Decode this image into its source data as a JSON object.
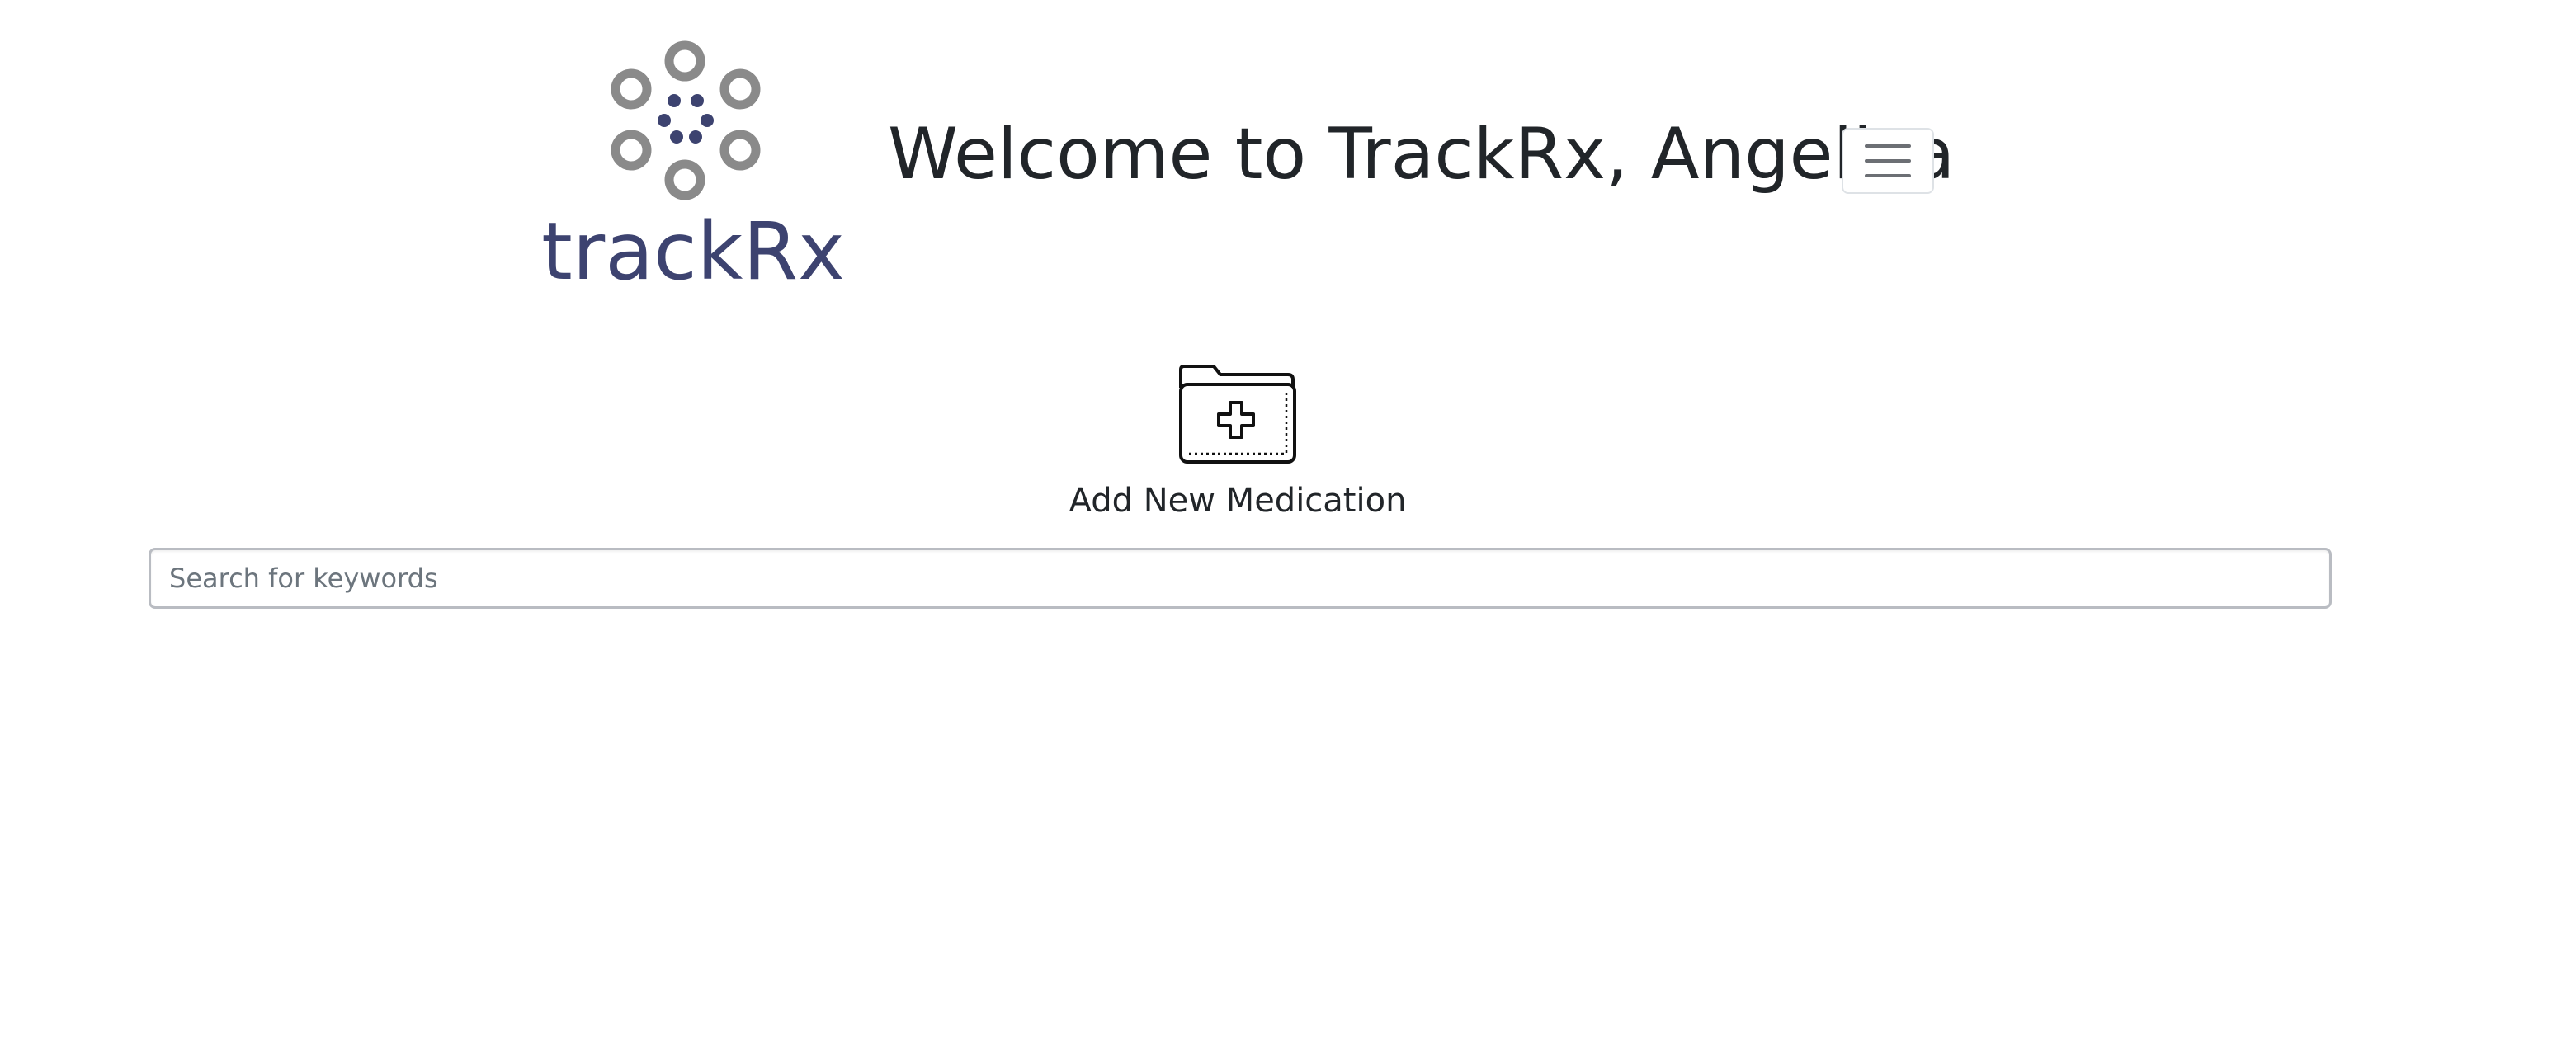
{
  "brand": {
    "logo_text": "trackRx",
    "icon_name": "pill-dots-logo-icon",
    "colors": {
      "ring_gray": "#8a8a8a",
      "navy": "#3d4370"
    }
  },
  "header": {
    "welcome_text": "Welcome to TrackRx, Angelica",
    "menu_icon": "hamburger-menu-icon"
  },
  "add_medication": {
    "label": "Add New Medication",
    "icon": "folder-plus-icon"
  },
  "search": {
    "placeholder": "Search for keywords",
    "value": ""
  }
}
